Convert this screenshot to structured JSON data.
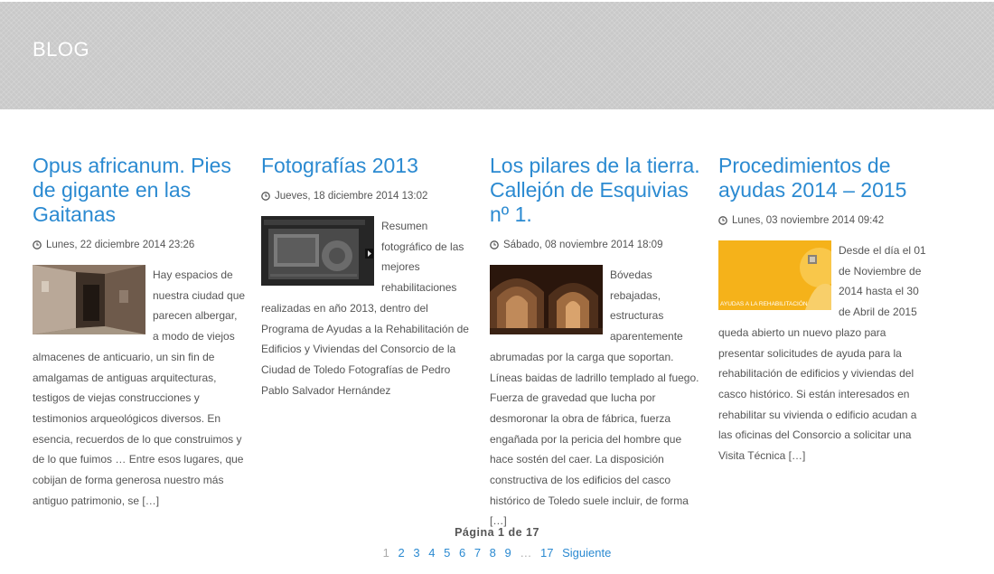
{
  "banner": {
    "title": "BLOG"
  },
  "posts": [
    {
      "title": "Opus africanum. Pies de gigante en las Gaitanas",
      "date": "Lunes, 22 diciembre 2014 23:26",
      "excerpt": "Hay espacios de nuestra ciudad que parecen albergar, a modo de viejos almacenes de anticuario, un sin fin de amalgamas de antiguas arquitecturas, testigos de viejas construcciones y testimonios arqueológicos diversos. En esencia, recuerdos de lo que construimos y de lo que fuimos …  Entre esos lugares, que cobijan de forma generosa nuestro más antiguo patrimonio, se ",
      "more": "[…]"
    },
    {
      "title": "Fotografías 2013",
      "date": "Jueves, 18 diciembre 2014 13:02",
      "excerpt": "Resumen fotográfico de las mejores rehabilitaciones realizadas en año 2013, dentro del Programa de Ayudas a la Rehabilitación de Edificios y Viviendas del Consorcio de la Ciudad de Toledo Fotografías de Pedro Pablo Salvador Hernández",
      "more": ""
    },
    {
      "title": "Los pilares de la tierra. Callejón de Esquivias nº 1.",
      "date": "Sábado, 08 noviembre 2014 18:09",
      "excerpt": "Bóvedas rebajadas, estructuras aparentemente abrumadas por la carga que soportan. Líneas baidas de ladrillo templado al fuego. Fuerza de gravedad que lucha por desmoronar la obra de fábrica, fuerza engañada por la pericia del hombre que hace sostén del caer. La disposición constructiva de los edificios del casco histórico de Toledo suele incluir, de forma ",
      "more": "[…]"
    },
    {
      "title": "Procedimientos de ayudas 2014 – 2015",
      "date": "Lunes, 03 noviembre 2014 09:42",
      "excerpt": "Desde el día el 01 de Noviembre de 2014 hasta el 30 de Abril de 2015 queda abierto un nuevo plazo para presentar solicitudes de ayuda para la rehabilitación de edificios y viviendas del casco histórico. Si están interesados en rehabilitar su vivienda o edificio acudan a las oficinas del Consorcio a solicitar una Visita Técnica ",
      "more": "[…]",
      "thumb_text": "AYUDAS A LA REHABILITACIÓN"
    }
  ],
  "pagination": {
    "summary": "Página 1 de 17",
    "current": "1",
    "pages": [
      "2",
      "3",
      "4",
      "5",
      "6",
      "7",
      "8",
      "9"
    ],
    "dots": "…",
    "last": "17",
    "next": "Siguiente"
  },
  "colors": {
    "link": "#2b8ad1",
    "text": "#555555",
    "banner": "#c9c9c9"
  }
}
